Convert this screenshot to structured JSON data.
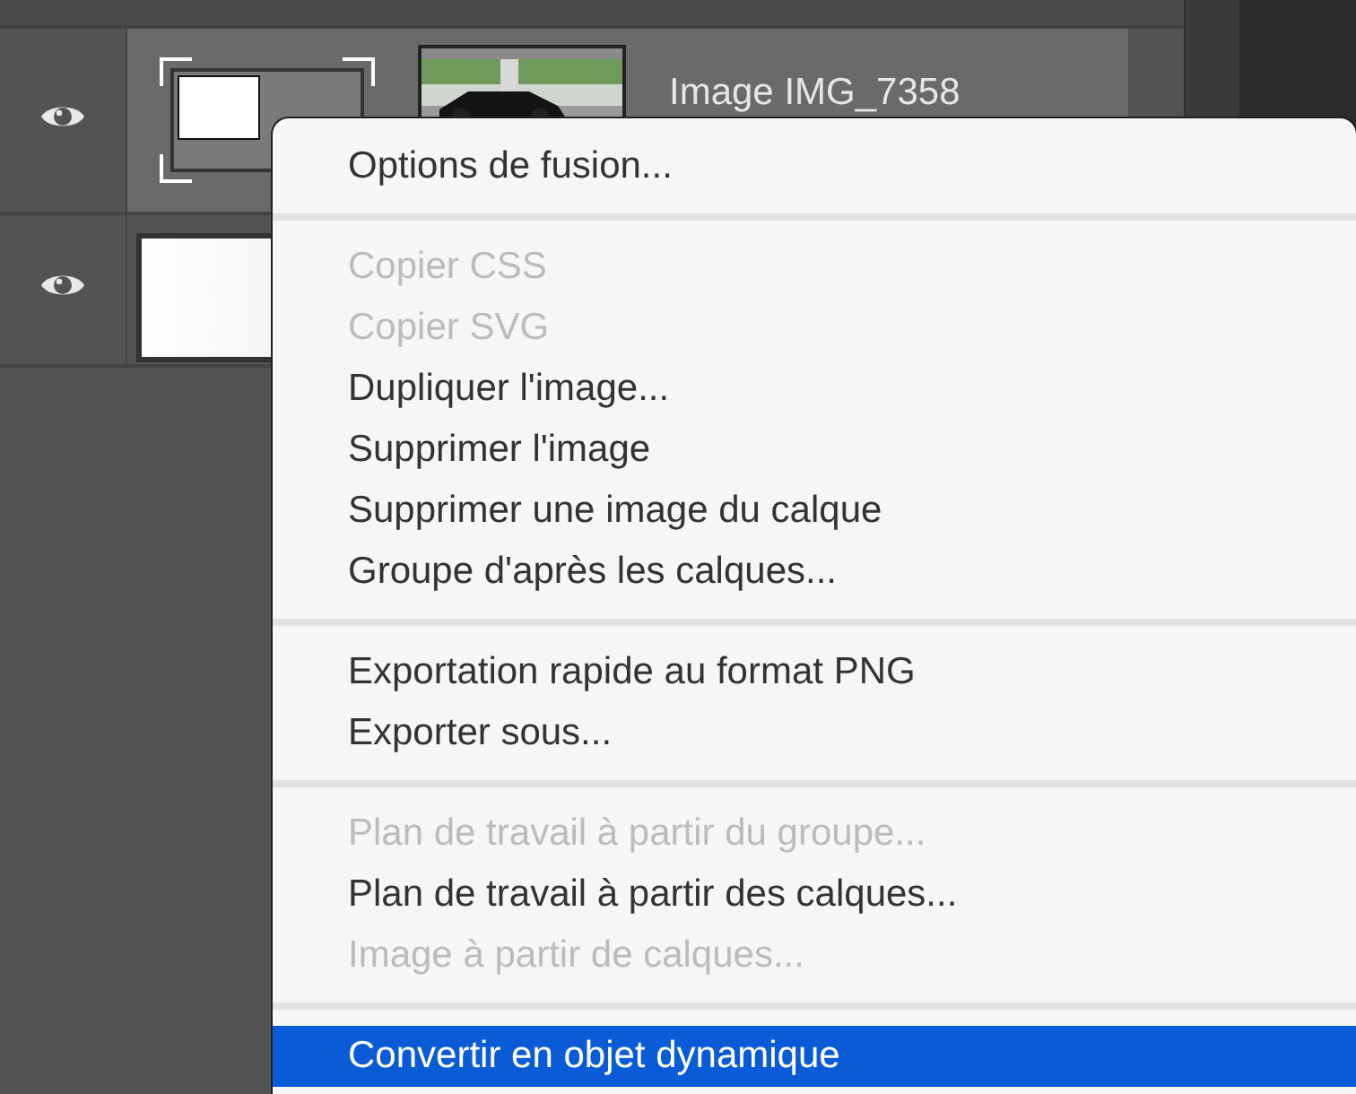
{
  "layers": [
    {
      "kind": "smart",
      "name": "Image IMG_7358",
      "visible": true,
      "selected": true
    },
    {
      "kind": "plain",
      "visible": true,
      "selected": false
    }
  ],
  "menu": {
    "groups": [
      [
        {
          "label": "Options de fusion...",
          "disabled": false,
          "selected": false
        }
      ],
      [
        {
          "label": "Copier CSS",
          "disabled": true,
          "selected": false
        },
        {
          "label": "Copier SVG",
          "disabled": true,
          "selected": false
        },
        {
          "label": "Dupliquer l'image...",
          "disabled": false,
          "selected": false
        },
        {
          "label": "Supprimer l'image",
          "disabled": false,
          "selected": false
        },
        {
          "label": "Supprimer une image du calque",
          "disabled": false,
          "selected": false
        },
        {
          "label": "Groupe d'après les calques...",
          "disabled": false,
          "selected": false
        }
      ],
      [
        {
          "label": "Exportation rapide au format PNG",
          "disabled": false,
          "selected": false
        },
        {
          "label": "Exporter sous...",
          "disabled": false,
          "selected": false
        }
      ],
      [
        {
          "label": "Plan de travail à partir du groupe...",
          "disabled": true,
          "selected": false
        },
        {
          "label": "Plan de travail à partir des calques...",
          "disabled": false,
          "selected": false
        },
        {
          "label": "Image à partir de calques...",
          "disabled": true,
          "selected": false
        }
      ],
      [
        {
          "label": "Convertir en objet dynamique",
          "disabled": false,
          "selected": true
        }
      ]
    ]
  }
}
